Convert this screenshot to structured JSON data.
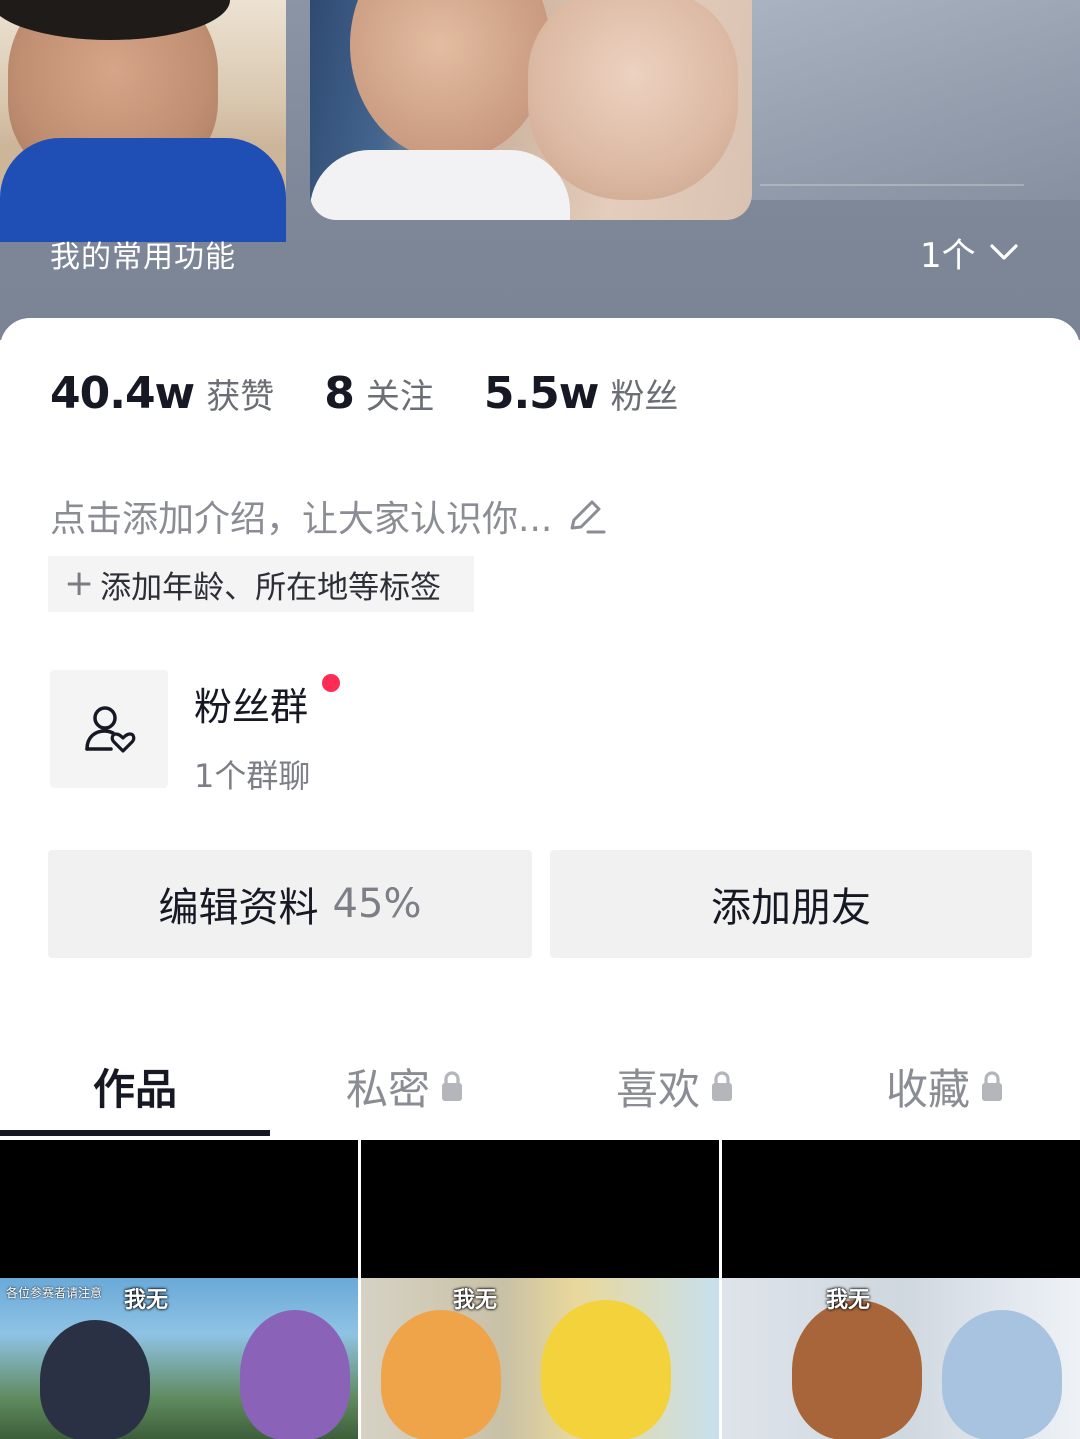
{
  "header": {
    "common_functions_label": "我的常用功能",
    "common_functions_count": "1个"
  },
  "stats": [
    {
      "value": "40.4w",
      "label": "获赞"
    },
    {
      "value": "8",
      "label": "关注"
    },
    {
      "value": "5.5w",
      "label": "粉丝"
    }
  ],
  "bio": {
    "placeholder": "点击添加介绍，让大家认识你..."
  },
  "tag_add": {
    "label": "添加年龄、所在地等标签",
    "prefix": "+"
  },
  "fan_group": {
    "title": "粉丝群",
    "subtitle": "1个群聊"
  },
  "actions": {
    "edit_profile": {
      "label": "编辑资料",
      "progress": "45%"
    },
    "add_friend": {
      "label": "添加朋友"
    }
  },
  "tabs": [
    {
      "label": "作品",
      "locked": false,
      "active": true
    },
    {
      "label": "私密",
      "locked": true,
      "active": false
    },
    {
      "label": "喜欢",
      "locked": true,
      "active": false
    },
    {
      "label": "收藏",
      "locked": true,
      "active": false
    }
  ],
  "videos": [
    {
      "caption": "我无",
      "small_caption": "各位参赛者请注意"
    },
    {
      "caption": "我无"
    },
    {
      "caption": "我无"
    }
  ],
  "colors": {
    "accent_red": "#fe2c55",
    "header_gray": "#7e8899",
    "text_primary": "#161823",
    "text_secondary": "#8b8d94"
  },
  "icons": {
    "count_toggle": "chevron-down-icon",
    "bio_edit": "pencil-icon",
    "fan_group": "user-heart-icon",
    "tab_lock": "lock-icon"
  }
}
